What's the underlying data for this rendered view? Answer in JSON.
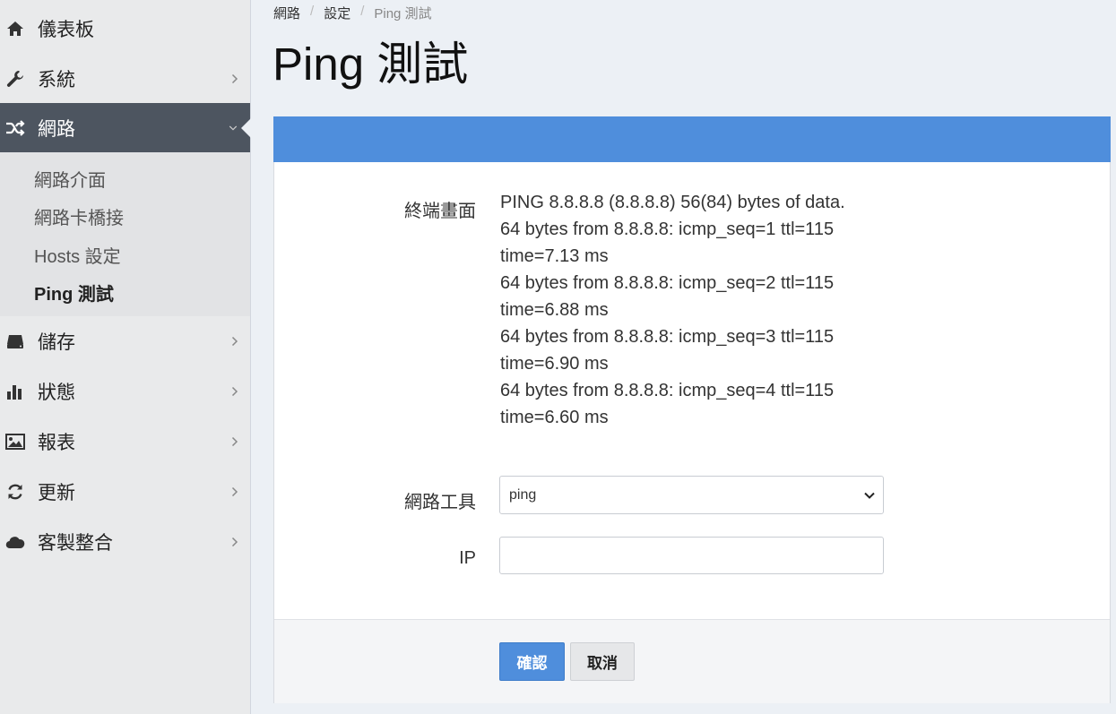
{
  "sidebar": {
    "items": [
      {
        "label": "儀表板",
        "icon": "home-icon"
      },
      {
        "label": "系統",
        "icon": "wrench-icon"
      },
      {
        "label": "網路",
        "icon": "shuffle-icon"
      },
      {
        "label": "儲存",
        "icon": "hdd-icon"
      },
      {
        "label": "狀態",
        "icon": "bar-chart-icon"
      },
      {
        "label": "報表",
        "icon": "image-icon"
      },
      {
        "label": "更新",
        "icon": "refresh-icon"
      },
      {
        "label": "客製整合",
        "icon": "cloud-icon"
      }
    ],
    "network_submenu": [
      "網路介面",
      "網路卡橋接",
      "Hosts 設定",
      "Ping 測試"
    ],
    "active_color": "#4d5560"
  },
  "breadcrumb": {
    "items": [
      "網路",
      "設定",
      "Ping 測試"
    ]
  },
  "page": {
    "title": "Ping 測試"
  },
  "form": {
    "header_color": "#4f8edc",
    "terminal_label": "終端畫面",
    "terminal_output": "PING 8.8.8.8 (8.8.8.8) 56(84) bytes of data.\n64 bytes from 8.8.8.8: icmp_seq=1 ttl=115\ntime=7.13 ms\n64 bytes from 8.8.8.8: icmp_seq=2 ttl=115\ntime=6.88 ms\n64 bytes from 8.8.8.8: icmp_seq=3 ttl=115\ntime=6.90 ms\n64 bytes from 8.8.8.8: icmp_seq=4 ttl=115\ntime=6.60 ms",
    "tool_label": "網路工具",
    "tool_value": "ping",
    "ip_label": "IP",
    "ip_value": "",
    "confirm_label": "確認",
    "cancel_label": "取消"
  }
}
